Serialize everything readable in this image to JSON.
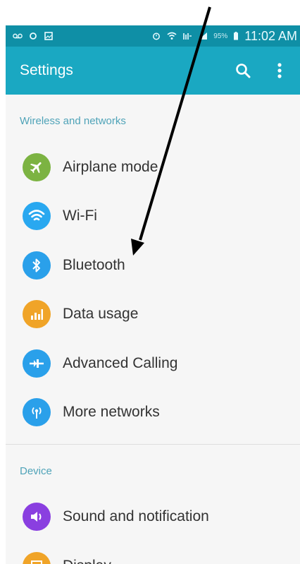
{
  "status_bar": {
    "battery_percent": "95%",
    "time": "11:02 AM",
    "icons": [
      "voicemail-icon",
      "sync-icon",
      "gallery-icon",
      "alarm-icon",
      "wifi-icon",
      "lte-icon",
      "signal-icon",
      "battery-icon"
    ]
  },
  "app_bar": {
    "title": "Settings",
    "actions": [
      "search-icon",
      "more-vert-icon"
    ]
  },
  "sections": [
    {
      "header": "Wireless and networks",
      "items": [
        {
          "label": "Airplane mode",
          "icon": "airplane-icon",
          "color": "#7cb342"
        },
        {
          "label": "Wi-Fi",
          "icon": "wifi-icon",
          "color": "#29a8f0"
        },
        {
          "label": "Bluetooth",
          "icon": "bluetooth-icon",
          "color": "#2aa0ea"
        },
        {
          "label": "Data usage",
          "icon": "data-usage-icon",
          "color": "#f0a428"
        },
        {
          "label": "Advanced Calling",
          "icon": "advanced-calling-icon",
          "color": "#2aa0ea"
        },
        {
          "label": "More networks",
          "icon": "more-networks-icon",
          "color": "#2aa0ea"
        }
      ]
    },
    {
      "header": "Device",
      "items": [
        {
          "label": "Sound and notification",
          "icon": "sound-icon",
          "color": "#8a3fe0"
        },
        {
          "label": "Display",
          "icon": "display-icon",
          "color": "#f0a428"
        }
      ]
    }
  ],
  "annotation": {
    "shape": "arrow",
    "color": "#000000",
    "points_to": "Bluetooth"
  }
}
